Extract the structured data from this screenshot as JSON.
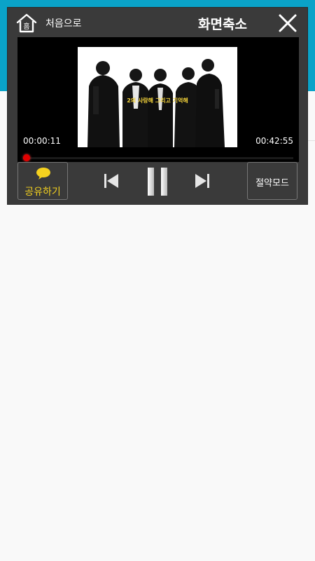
{
  "colors": {
    "header_accent": "#0aa3c8",
    "player_bg": "#3a3a3a",
    "seek_fill": "#d00000",
    "share_label": "#f5d21f",
    "subtitle_text": "#f2d23a"
  },
  "header": {
    "home_icon": "home-icon",
    "home_icon_glyph": "홈",
    "home_label": "처음으로",
    "title": "화면축소",
    "close_icon": "close-icon"
  },
  "video": {
    "subtitle": "2의 사랑해 그리고 기억해",
    "current_time": "00:00:11",
    "total_time": "00:42:55",
    "progress_fraction": 0.004
  },
  "controls": {
    "share_icon": "speech-bubble-icon",
    "share_label": "공유하기",
    "prev_icon": "skip-previous-icon",
    "pause_icon": "pause-icon",
    "next_icon": "skip-next-icon",
    "eco_label": "절약모드"
  }
}
